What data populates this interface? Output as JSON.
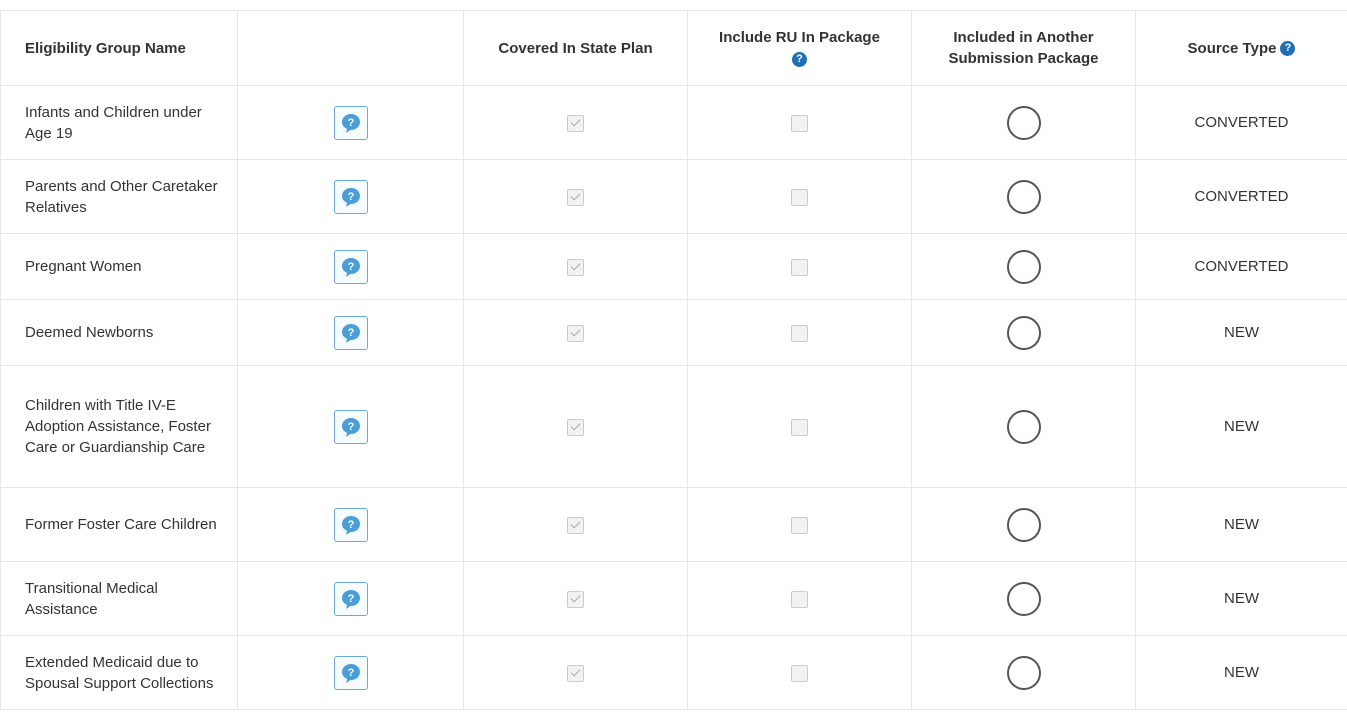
{
  "headers": {
    "name": "Eligibility Group Name",
    "blank": "",
    "covered": "Covered In State Plan",
    "include_ru_line1": "Include RU In Package",
    "included_line1": "Included in Another",
    "included_line2": "Submission Package",
    "source": "Source Type",
    "help_glyph": "?"
  },
  "icons": {
    "help_button": "speech-bubble-question-icon",
    "header_help": "question-circle-icon"
  },
  "colors": {
    "accent": "#1f6fb2",
    "help_bubble": "#4b9fd8"
  },
  "rows": [
    {
      "name": "Infants and Children under Age 19",
      "covered": true,
      "include_ru": false,
      "included_other": false,
      "source": "CONVERTED"
    },
    {
      "name": "Parents and Other Caretaker Relatives",
      "covered": true,
      "include_ru": false,
      "included_other": false,
      "source": "CONVERTED"
    },
    {
      "name": "Pregnant Women",
      "covered": true,
      "include_ru": false,
      "included_other": false,
      "source": "CONVERTED"
    },
    {
      "name": "Deemed Newborns",
      "covered": true,
      "include_ru": false,
      "included_other": false,
      "source": "NEW"
    },
    {
      "name": "Children with Title IV-E Adoption Assistance, Foster Care or Guardianship Care",
      "covered": true,
      "include_ru": false,
      "included_other": false,
      "source": "NEW"
    },
    {
      "name": "Former Foster Care Children",
      "covered": true,
      "include_ru": false,
      "included_other": false,
      "source": "NEW"
    },
    {
      "name": "Transitional Medical Assistance",
      "covered": true,
      "include_ru": false,
      "included_other": false,
      "source": "NEW"
    },
    {
      "name": "Extended Medicaid due to Spousal Support Collections",
      "covered": true,
      "include_ru": false,
      "included_other": false,
      "source": "NEW"
    }
  ]
}
